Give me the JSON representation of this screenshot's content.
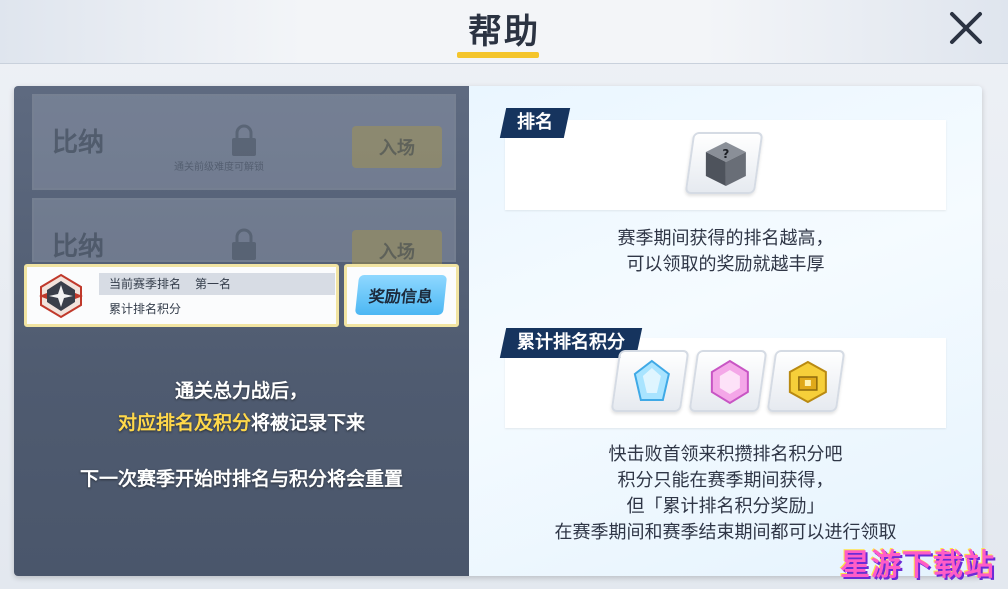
{
  "header": {
    "title": "帮助",
    "close_icon": "close-icon"
  },
  "left_panel": {
    "locked_rows": [
      {
        "name": "比纳",
        "hint": "通关前级难度可解锁",
        "button": "入场"
      },
      {
        "name": "比纳",
        "hint": "",
        "button": "入场"
      }
    ],
    "rank_card": {
      "rank_label": "当前赛季排名",
      "rank_value": "第一名",
      "points_label": "累计排名积分"
    },
    "reward_button": "奖励信息",
    "text_line1": "通关总力战后，",
    "text_line2_highlight": "对应排名及积分",
    "text_line2_rest": "将被记录下来",
    "text_line3": "下一次赛季开始时排名与积分将会重置"
  },
  "right_panel": {
    "ranking": {
      "tag": "排名",
      "icon": "mystery-cube-icon",
      "desc_line1": "赛季期间获得的排名越高，",
      "desc_line2": "可以领取的奖励就越丰厚"
    },
    "points": {
      "tag": "累计排名积分",
      "icons": [
        "blue-crystal-icon",
        "pink-crystal-icon",
        "gold-chest-icon"
      ],
      "desc_line1": "快击败首领来积攒排名积分吧",
      "desc_line2": "积分只能在赛季期间获得，",
      "desc_line3": "但「累计排名积分奖励」",
      "desc_line4": "在赛季期间和赛季结束期间都可以进行领取"
    }
  },
  "watermark": "星游下载站",
  "colors": {
    "accent_yellow": "#f4c52c",
    "tag_navy": "#16345e",
    "button_blue": "#4cb7f3",
    "highlight_yellow": "#ffd84a"
  }
}
